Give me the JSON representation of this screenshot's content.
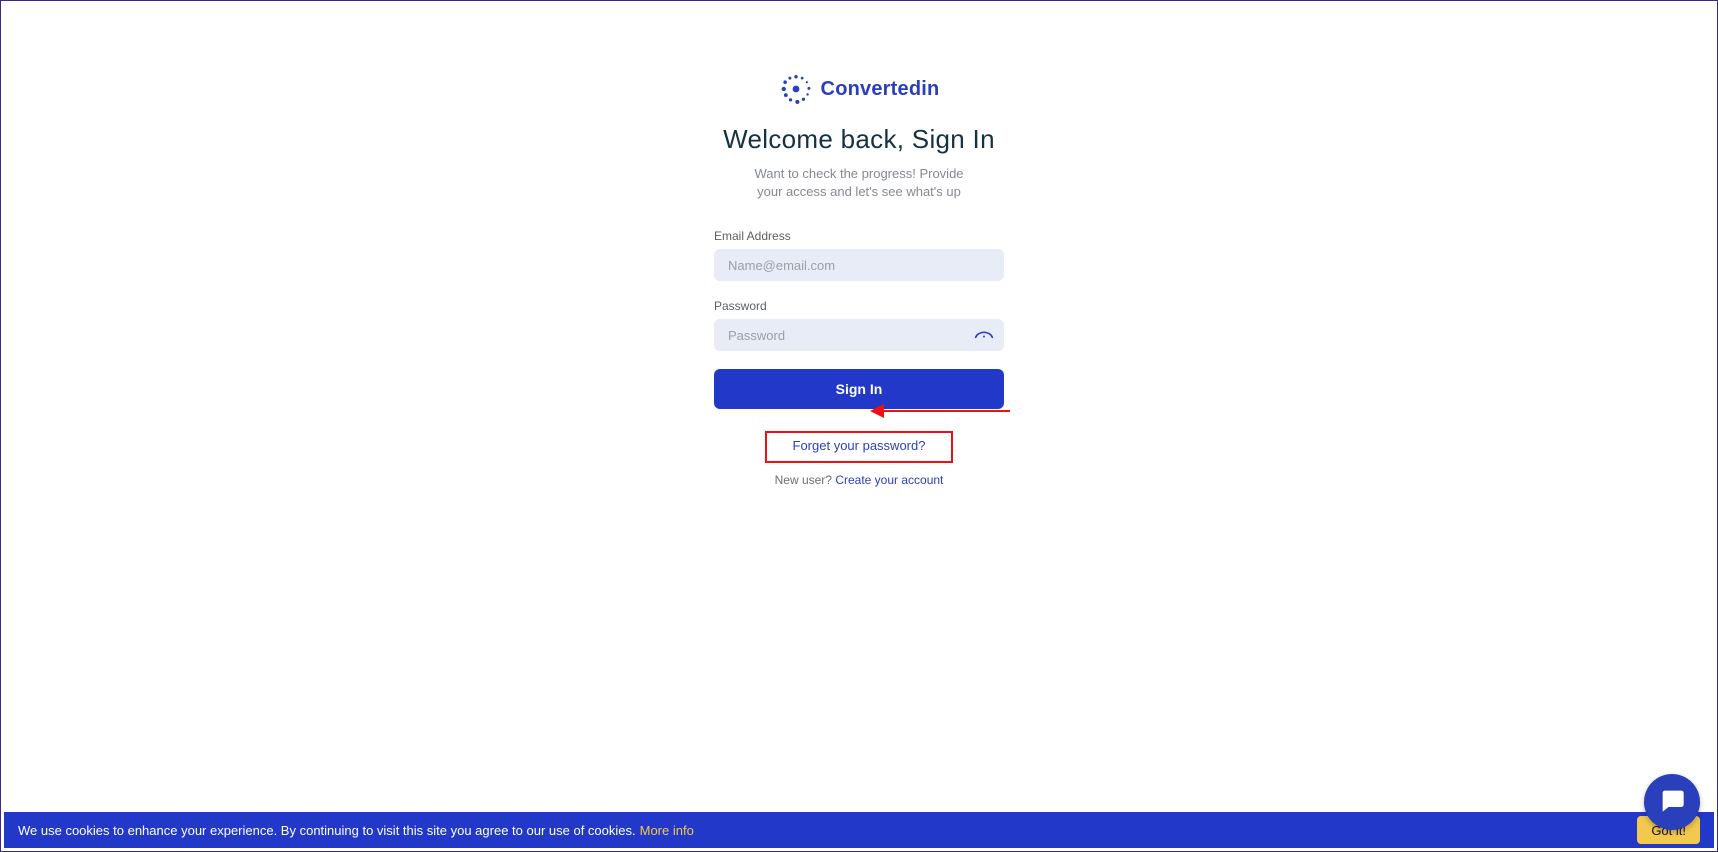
{
  "brand": {
    "name": "Convertedin"
  },
  "header": {
    "title": "Welcome back, Sign In",
    "subtitle": "Want to check the progress! Provide your access and let's see what's up"
  },
  "form": {
    "email_label": "Email Address",
    "email_placeholder": "Name@email.com",
    "email_value": "",
    "password_label": "Password",
    "password_placeholder": "Password",
    "password_value": "",
    "submit_label": "Sign In",
    "forgot_label": "Forget your password?",
    "new_user_prompt": "New user? ",
    "create_account_label": "Create your account"
  },
  "cookie": {
    "text": "We use cookies to enhance your experience. By continuing to visit this site you agree to our use of cookies.",
    "more_label": "More info",
    "accept_label": "Got it!"
  }
}
